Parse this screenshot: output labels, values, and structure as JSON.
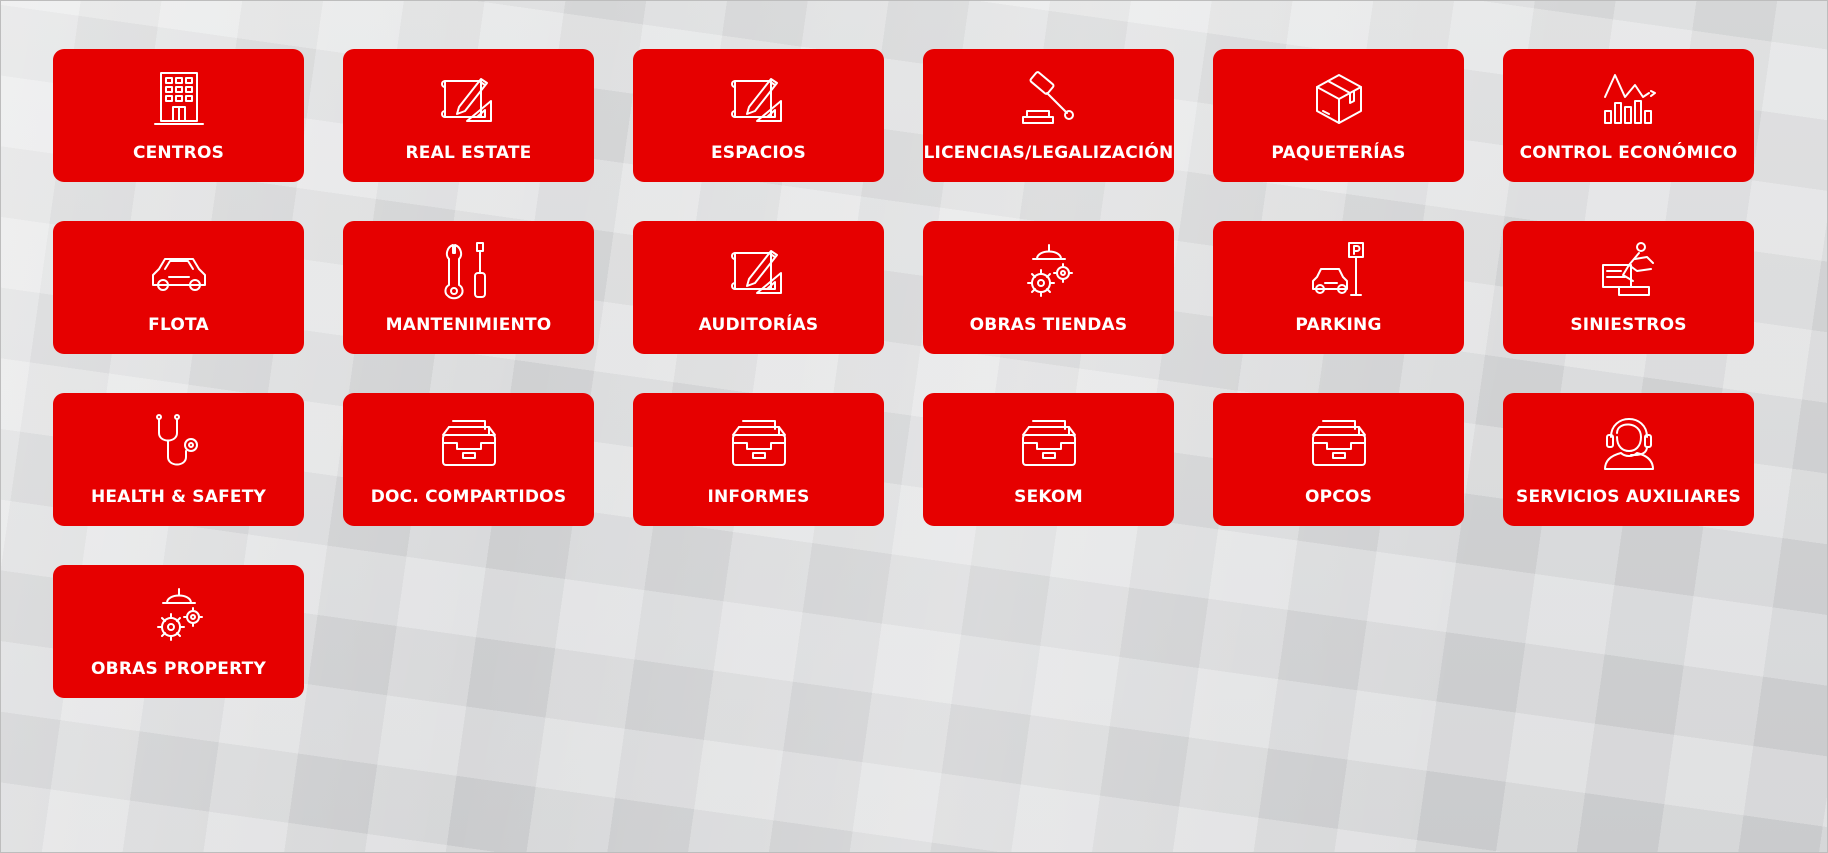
{
  "brand": {
    "tile_color": "#e60000",
    "text_color": "#ffffff"
  },
  "tiles": [
    {
      "label": "CENTROS",
      "icon": "building-icon"
    },
    {
      "label": "REAL ESTATE",
      "icon": "blueprint-icon"
    },
    {
      "label": "ESPACIOS",
      "icon": "blueprint-icon"
    },
    {
      "label": "LICENCIAS/LEGALIZACIÓN",
      "icon": "gavel-icon"
    },
    {
      "label": "PAQUETERÍAS",
      "icon": "package-icon"
    },
    {
      "label": "CONTROL ECONÓMICO",
      "icon": "bar-chart-icon"
    },
    {
      "label": "FLOTA",
      "icon": "car-icon"
    },
    {
      "label": "MANTENIMIENTO",
      "icon": "tools-icon"
    },
    {
      "label": "AUDITORÍAS",
      "icon": "blueprint-icon"
    },
    {
      "label": "OBRAS TIENDAS",
      "icon": "helmet-gears-icon"
    },
    {
      "label": "PARKING",
      "icon": "parking-icon"
    },
    {
      "label": "SINIESTROS",
      "icon": "accident-icon"
    },
    {
      "label": "HEALTH & SAFETY",
      "icon": "stethoscope-icon"
    },
    {
      "label": "DOC. COMPARTIDOS",
      "icon": "archive-tray-icon"
    },
    {
      "label": "INFORMES",
      "icon": "archive-tray-icon"
    },
    {
      "label": "SEKOM",
      "icon": "archive-tray-icon"
    },
    {
      "label": "OPCOS",
      "icon": "archive-tray-icon"
    },
    {
      "label": "SERVICIOS AUXILIARES",
      "icon": "headset-icon"
    },
    {
      "label": "OBRAS PROPERTY",
      "icon": "helmet-gears-icon"
    }
  ]
}
